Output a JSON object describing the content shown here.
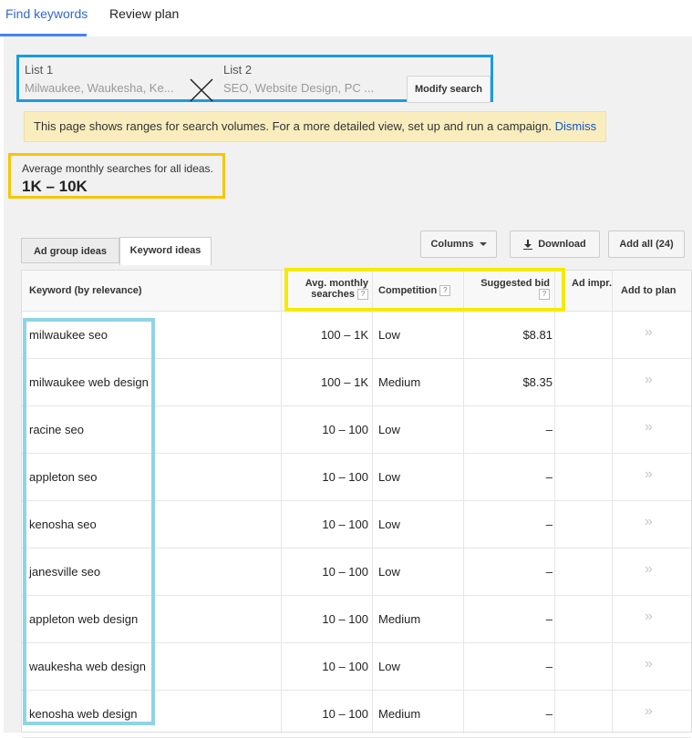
{
  "top_tabs": {
    "find": "Find keywords",
    "review": "Review plan"
  },
  "lists": {
    "list1_label": "List 1",
    "list1_value": "Milwaukee, Waukesha, Ke...",
    "list2_label": "List 2",
    "list2_value": "SEO, Website Design, PC ...",
    "modify": "Modify search"
  },
  "notice": {
    "text": "This page shows ranges for search volumes. For a more detailed view, set up and run a campaign.",
    "dismiss": "Dismiss"
  },
  "average": {
    "label": "Average monthly searches for all ideas.",
    "value": "1K – 10K"
  },
  "section_tabs": {
    "ad_group": "Ad group ideas",
    "keyword": "Keyword ideas"
  },
  "buttons": {
    "columns": "Columns",
    "download": "Download",
    "add_all": "Add all (24)"
  },
  "headers": {
    "keyword": "Keyword (by relevance)",
    "avg1": "Avg. monthly",
    "avg2": "searches",
    "competition": "Competition",
    "bid": "Suggested bid",
    "ad": "Ad impr.",
    "add": "Add to plan"
  },
  "rows": [
    {
      "keyword": "milwaukee seo",
      "avg": "100 – 1K",
      "competition": "Low",
      "bid": "$8.81",
      "add": "»"
    },
    {
      "keyword": "milwaukee web design",
      "avg": "100 – 1K",
      "competition": "Medium",
      "bid": "$8.35",
      "add": "»"
    },
    {
      "keyword": "racine seo",
      "avg": "10 – 100",
      "competition": "Low",
      "bid": "–",
      "add": "»"
    },
    {
      "keyword": "appleton seo",
      "avg": "10 – 100",
      "competition": "Low",
      "bid": "–",
      "add": "»"
    },
    {
      "keyword": "kenosha seo",
      "avg": "10 – 100",
      "competition": "Low",
      "bid": "–",
      "add": "»"
    },
    {
      "keyword": "janesville seo",
      "avg": "10 – 100",
      "competition": "Low",
      "bid": "–",
      "add": "»"
    },
    {
      "keyword": "appleton web design",
      "avg": "10 – 100",
      "competition": "Medium",
      "bid": "–",
      "add": "»"
    },
    {
      "keyword": "waukesha web design",
      "avg": "10 – 100",
      "competition": "Low",
      "bid": "–",
      "add": "»"
    },
    {
      "keyword": "kenosha web design",
      "avg": "10 – 100",
      "competition": "Medium",
      "bid": "–",
      "add": "»"
    }
  ],
  "colors": {
    "accent": "#4285f4",
    "list_box": "#1a9ce0",
    "avg_box": "#f7c600",
    "header_highlight": "#f4ec00",
    "keyword_highlight": "#8fd4e6"
  }
}
